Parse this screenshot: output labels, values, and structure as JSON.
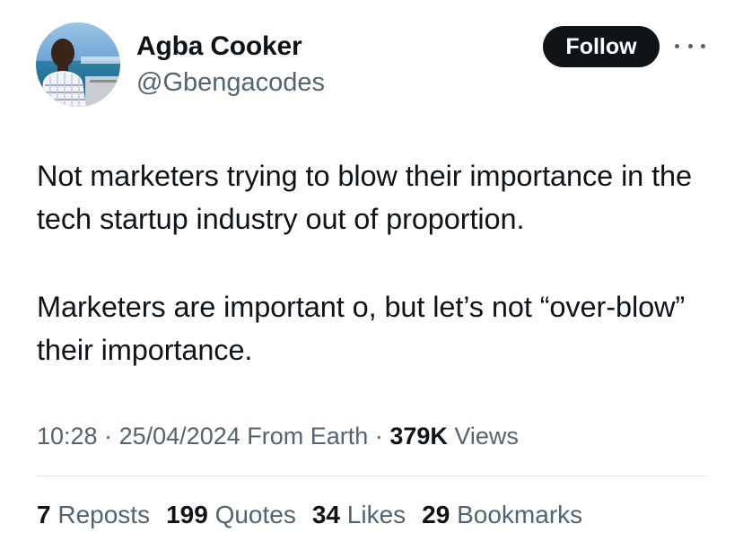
{
  "author": {
    "display_name": "Agba Cooker",
    "handle": "@Gbengacodes",
    "avatar_icon": "profile-photo"
  },
  "actions": {
    "follow_label": "Follow",
    "more_icon": "more-horizontal-icon"
  },
  "tweet": {
    "paragraphs": [
      "Not marketers trying to blow their importance in the tech startup industry out of proportion.",
      "Marketers are important o, but let’s not “over-blow” their importance."
    ]
  },
  "meta": {
    "time": "10:28",
    "separator": "·",
    "date": "25/04/2024",
    "source": "From Earth",
    "views_count": "379K",
    "views_label": "Views"
  },
  "stats": [
    {
      "count": "7",
      "label": "Reposts"
    },
    {
      "count": "199",
      "label": "Quotes"
    },
    {
      "count": "34",
      "label": "Likes"
    },
    {
      "count": "29",
      "label": "Bookmarks"
    }
  ],
  "colors": {
    "text_primary": "#0f1419",
    "text_secondary": "#536471",
    "follow_bg": "#0f1419",
    "divider": "#e1e6ea"
  }
}
